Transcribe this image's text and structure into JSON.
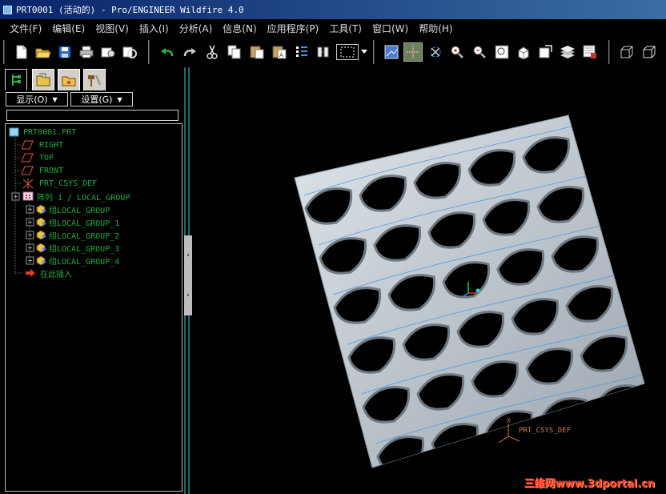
{
  "window": {
    "title": "PRT0001 (活动的) - Pro/ENGINEER Wildfire 4.0"
  },
  "menu": {
    "items": [
      "文件(F)",
      "编辑(E)",
      "视图(V)",
      "插入(I)",
      "分析(A)",
      "信息(N)",
      "应用程序(P)",
      "工具(T)",
      "窗口(W)",
      "帮助(H)"
    ]
  },
  "toolbar": {
    "buttons": [
      "new-icon",
      "open-icon",
      "save-icon",
      "print-icon",
      "send-icon",
      "regen-icon",
      "undo-icon",
      "redo-icon",
      "cut-icon",
      "copy-icon",
      "paste-icon",
      "paste-special-icon",
      "regenerate-icon",
      "find-icon",
      "select-box-icon",
      "repaint-icon",
      "spin-center-icon",
      "orient-icon",
      "zoom-in-icon",
      "zoom-out-icon",
      "refit-icon",
      "reorient-icon",
      "saved-views-icon",
      "layers-icon",
      "view-manager-icon",
      "wireframe-icon",
      "hidden-line-icon"
    ],
    "active": "spin-center-icon"
  },
  "panel": {
    "tabs": [
      "model-tree-icon",
      "folder-browser-icon",
      "favorites-icon",
      "connections-icon"
    ],
    "show_label": "显示(O)",
    "settings_label": "设置(G)",
    "search_value": "",
    "tree": [
      {
        "label": "PRT0001.PRT",
        "type": "part",
        "level": 0
      },
      {
        "label": "RIGHT",
        "type": "datum-plane",
        "level": 1
      },
      {
        "label": "TOP",
        "type": "datum-plane",
        "level": 1
      },
      {
        "label": "FRONT",
        "type": "datum-plane",
        "level": 1
      },
      {
        "label": "PRT_CSYS_DEF",
        "type": "csys",
        "level": 1
      },
      {
        "label": "阵列 1 / LOCAL_GROUP",
        "type": "pattern",
        "level": 1
      },
      {
        "label": "组LOCAL_GROUP",
        "type": "group",
        "level": 2
      },
      {
        "label": "组LOCAL_GROUP_1",
        "type": "group",
        "level": 2
      },
      {
        "label": "组LOCAL_GROUP_2",
        "type": "group",
        "level": 2
      },
      {
        "label": "组LOCAL_GROUP_3",
        "type": "group",
        "level": 2
      },
      {
        "label": "组LOCAL_GROUP_4",
        "type": "group",
        "level": 2
      },
      {
        "label": "在此插入",
        "type": "insert-here",
        "level": 1
      }
    ]
  },
  "viewport": {
    "csys_label": "PRT_CSYS_DEF",
    "watermark": "三维网www.3dportal.cn"
  },
  "colors": {
    "background": "#000000",
    "tree_text": "#1fae3f",
    "model_surface": "#c7cfd6",
    "edge_lines": "#4f9ae8"
  }
}
